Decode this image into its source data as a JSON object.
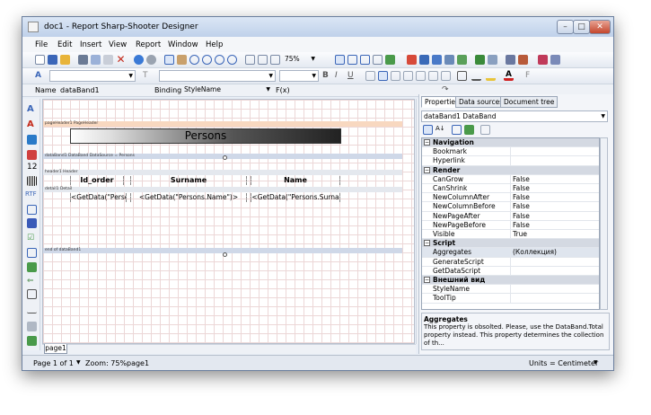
{
  "window": {
    "title": "doc1 - Report Sharp-Shooter Designer"
  },
  "menu": [
    "File",
    "Edit",
    "Insert",
    "View",
    "Report",
    "Window",
    "Help"
  ],
  "toolbar": {
    "zoom_value": "75%"
  },
  "namebar": {
    "name_label": "Name",
    "name_value": "dataBand1",
    "binding_label": "Binding",
    "binding_value": "StyleName",
    "fx_label": "F(x)"
  },
  "canvas": {
    "page_header_band": "pageHeader1 PageHeader",
    "title_text": "Persons",
    "data_band": "dataBand1 DataBand DataSource = Persons",
    "header_band": "header1 Header",
    "columns": [
      "Id_order",
      "Surname",
      "Name"
    ],
    "detail_band": "detail1 Detail",
    "cells": [
      "<GetData(\"Perso",
      "<GetData(\"Persons.Name\")>",
      "<GetData(\"Persons.Surna"
    ],
    "end_band": "end of dataBand1",
    "page_tab": "page1"
  },
  "panel": {
    "tabs": [
      "Properties",
      "Data sources",
      "Document tree"
    ],
    "object_selector": "dataBand1 DataBand",
    "rows": [
      {
        "type": "cat",
        "name": "Navigation"
      },
      {
        "type": "prop",
        "name": "Bookmark",
        "value": ""
      },
      {
        "type": "prop",
        "name": "Hyperlink",
        "value": ""
      },
      {
        "type": "cat",
        "name": "Render"
      },
      {
        "type": "prop",
        "name": "CanGrow",
        "value": "False"
      },
      {
        "type": "prop",
        "name": "CanShrink",
        "value": "False"
      },
      {
        "type": "prop",
        "name": "NewColumnAfter",
        "value": "False"
      },
      {
        "type": "prop",
        "name": "NewColumnBefore",
        "value": "False"
      },
      {
        "type": "prop",
        "name": "NewPageAfter",
        "value": "False"
      },
      {
        "type": "prop",
        "name": "NewPageBefore",
        "value": "False"
      },
      {
        "type": "prop",
        "name": "Visible",
        "value": "True"
      },
      {
        "type": "cat",
        "name": "Script"
      },
      {
        "type": "sel",
        "name": "Aggregates",
        "value": "(Коллекция)"
      },
      {
        "type": "prop",
        "name": "GenerateScript",
        "value": ""
      },
      {
        "type": "prop",
        "name": "GetDataScript",
        "value": ""
      },
      {
        "type": "cat",
        "name": "Внешний вид"
      },
      {
        "type": "prop",
        "name": "StyleName",
        "value": ""
      },
      {
        "type": "prop",
        "name": "ToolTip",
        "value": ""
      }
    ],
    "desc_title": "Aggregates",
    "desc_text": "This property is obsolted. Please, use the DataBand.Total property instead. This property determines the collection of th..."
  },
  "status": {
    "page": "Page 1 of 1",
    "zoom": "Zoom: 75%",
    "page_name": "page1",
    "units": "Units = Centimeter"
  }
}
